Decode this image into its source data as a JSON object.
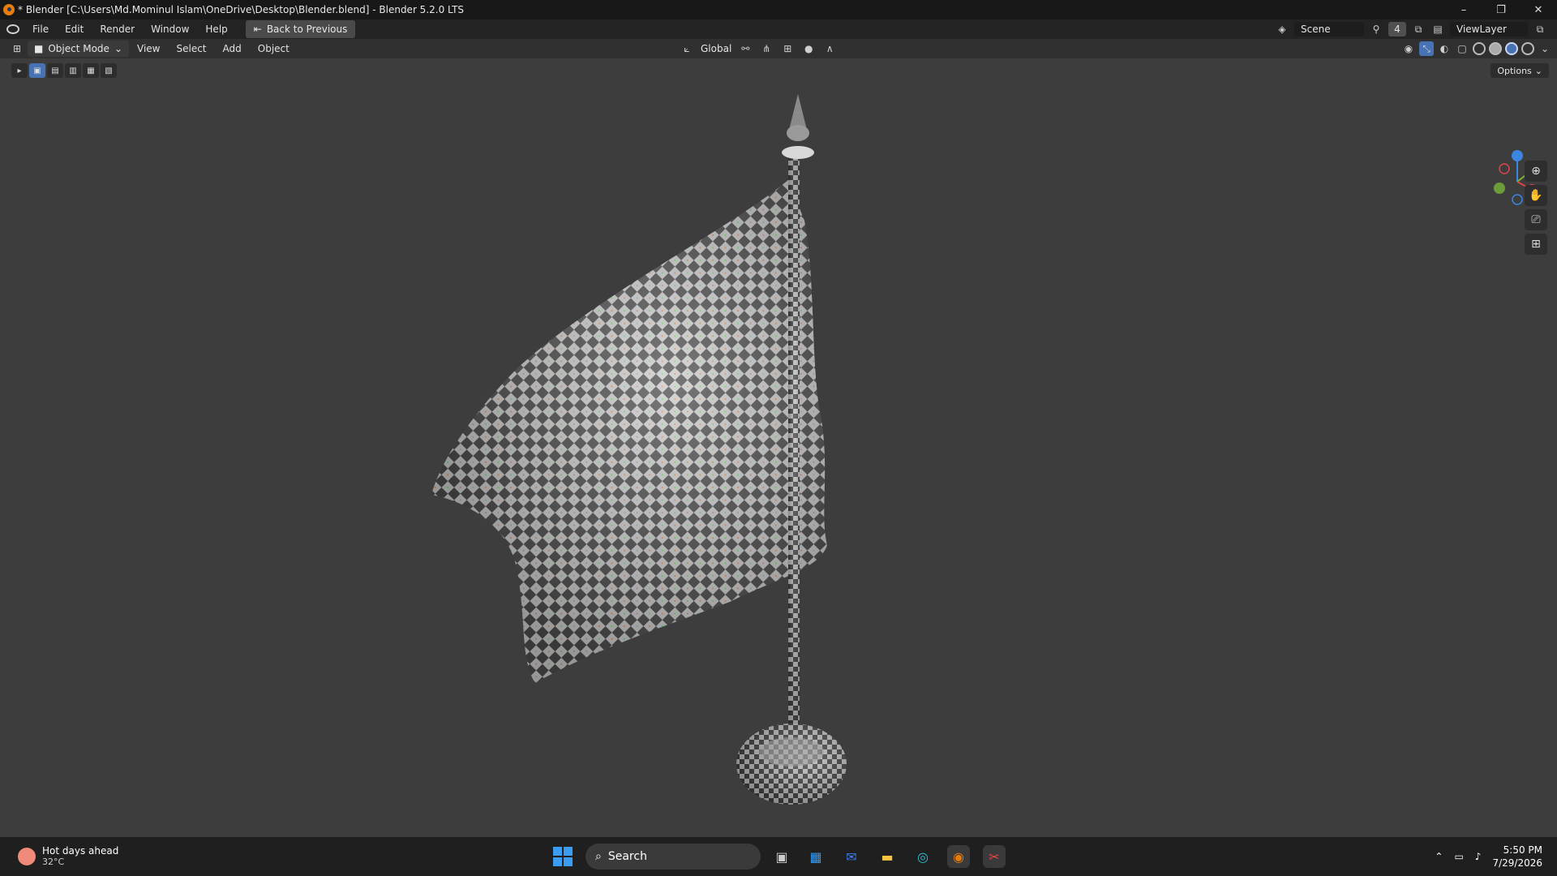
{
  "window": {
    "title": "* Blender [C:\\Users\\Md.Mominul Islam\\OneDrive\\Desktop\\Blender.blend] - Blender 5.2.0 LTS",
    "controls": [
      "–",
      "❐",
      "✕"
    ]
  },
  "menubar": {
    "items": [
      "File",
      "Edit",
      "Render",
      "Window",
      "Help"
    ],
    "back_button": "Back to Previous",
    "scene_name": "Scene",
    "scene_count": "4",
    "view_layer": "ViewLayer"
  },
  "viewport_header": {
    "mode": "Object Mode",
    "menus": [
      "View",
      "Select",
      "Add",
      "Object"
    ],
    "transform_orientation": "Global",
    "options_label": "Options"
  },
  "taskbar": {
    "weather_title": "Hot days ahead",
    "weather_temp": "32°C",
    "search_placeholder": "Search",
    "time": "5:50 PM",
    "date": "7/29/2026"
  },
  "colors": {
    "accent": "#4772b3",
    "axis_x": "#e0424a",
    "axis_y": "#7bb33a",
    "axis_z": "#3b86e0"
  }
}
